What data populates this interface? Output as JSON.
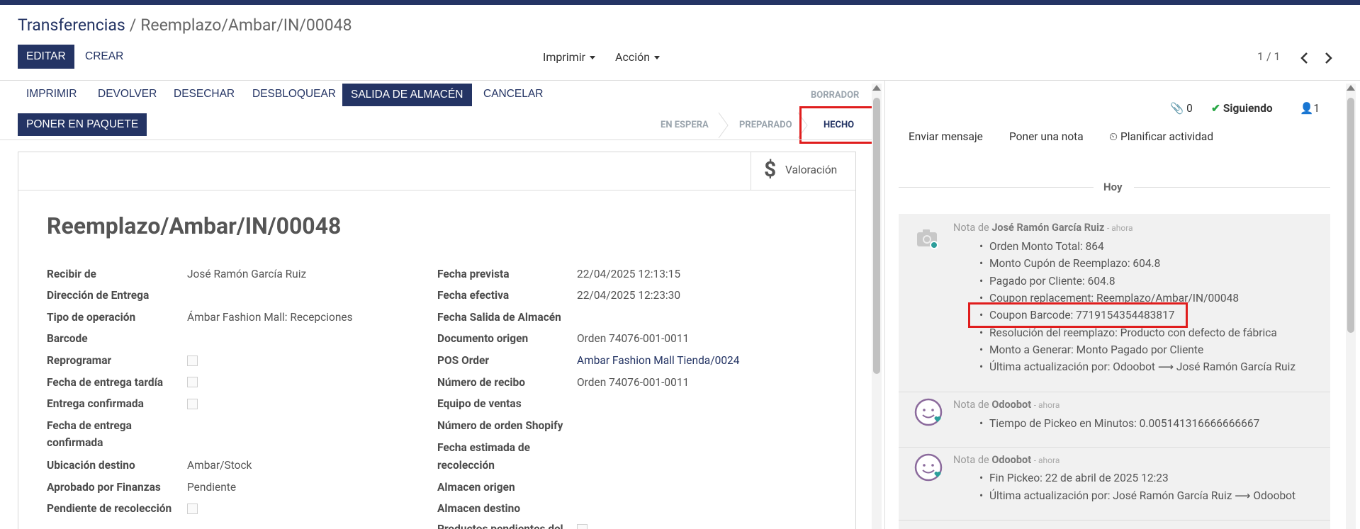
{
  "breadcrumb": {
    "parent": "Transferencias",
    "separator": "/",
    "current": "Reemplazo/Ambar/IN/00048"
  },
  "control": {
    "edit": "EDITAR",
    "create": "CREAR",
    "print": "Imprimir",
    "action": "Acción",
    "pager": "1 / 1"
  },
  "actions": {
    "print": "IMPRIMIR",
    "return": "DEVOLVER",
    "scrap": "DESECHAR",
    "unlock": "DESBLOQUEAR",
    "salida": "SALIDA DE ALMACÉN",
    "cancel": "CANCELAR",
    "package": "PONER EN PAQUETE"
  },
  "statusbar": {
    "draft": "BORRADOR",
    "waiting": "EN ESPERA",
    "ready": "PREPARADO",
    "done": "HECHO"
  },
  "smart_button": {
    "label": "Valoración",
    "icon": "dollar-icon"
  },
  "record": {
    "title": "Reemplazo/Ambar/IN/00048"
  },
  "left_fields": [
    {
      "label": "Recibir de",
      "value": "José Ramón García Ruiz"
    },
    {
      "label": "Dirección de Entrega",
      "value": ""
    },
    {
      "label": "Tipo de operación",
      "value": "Ámbar Fashion Mall: Recepciones"
    },
    {
      "label": "Barcode",
      "value": ""
    },
    {
      "label": "Reprogramar",
      "value": ""
    },
    {
      "label": "Fecha de entrega tardía",
      "value": ""
    },
    {
      "label": "Entrega confirmada",
      "value": ""
    },
    {
      "label": "Fecha de entrega",
      "label2": "confirmada",
      "value": ""
    },
    {
      "label": "Ubicación destino",
      "value": "Ambar/Stock"
    },
    {
      "label": "Aprobado por Finanzas",
      "value": "Pendiente"
    },
    {
      "label": "Pendiente de recolección",
      "value": ""
    }
  ],
  "right_fields": [
    {
      "label": "Fecha prevista",
      "value": "22/04/2025 12:13:15"
    },
    {
      "label": "Fecha efectiva",
      "value": "22/04/2025 12:23:30"
    },
    {
      "label": "Fecha Salida de Almacén",
      "value": ""
    },
    {
      "label": "Documento origen",
      "value": "Orden 74076-001-0011"
    },
    {
      "label": "POS Order",
      "value": "Ambar Fashion Mall Tienda/0024"
    },
    {
      "label": "Número de recibo",
      "value": "Orden 74076-001-0011"
    },
    {
      "label": "Equipo de ventas",
      "value": ""
    },
    {
      "label": "Número de orden Shopify",
      "value": ""
    },
    {
      "label": "Fecha estimada de",
      "label2": "recolección",
      "value": ""
    },
    {
      "label": "Almacen origen",
      "value": ""
    },
    {
      "label": "Almacen destino",
      "value": ""
    },
    {
      "label": "Productos pendientes del",
      "value": ""
    }
  ],
  "chatter": {
    "attachments": "0",
    "following": "Siguiendo",
    "followers": "1",
    "send_message": "Enviar mensaje",
    "log_note": "Poner una nota",
    "schedule": "Planificar actividad",
    "date_separator": "Hoy",
    "messages": [
      {
        "prefix": "Nota de",
        "author": "José Ramón García Ruiz",
        "time": "- ahora",
        "lines": [
          "Orden Monto Total: 864",
          "Monto Cupón de Reemplazo: 604.8",
          "Pagado por Cliente: 604.8",
          "Coupon replacement: Reemplazo/Ambar/IN/00048",
          "Coupon Barcode: 7719154354483817",
          "Resolución del reemplazo: Producto con defecto de fábrica",
          "Monto a Generar: Monto Pagado por Cliente",
          "Última actualización por: Odoobot ⟶ José Ramón García Ruiz"
        ]
      },
      {
        "prefix": "Nota de",
        "author": "Odoobot",
        "time": "- ahora",
        "lines": [
          "Tiempo de Pickeo en Minutos: 0.005141316666666667"
        ]
      },
      {
        "prefix": "Nota de",
        "author": "Odoobot",
        "time": "- ahora",
        "lines": [
          "Fin Pickeo: 22 de abril de 2025 12:23",
          "Última actualización por: José Ramón García Ruiz ⟶ Odoobot"
        ]
      }
    ]
  },
  "colors": {
    "brand": "#243464",
    "highlight": "#e01d1d",
    "following": "#28a745"
  }
}
